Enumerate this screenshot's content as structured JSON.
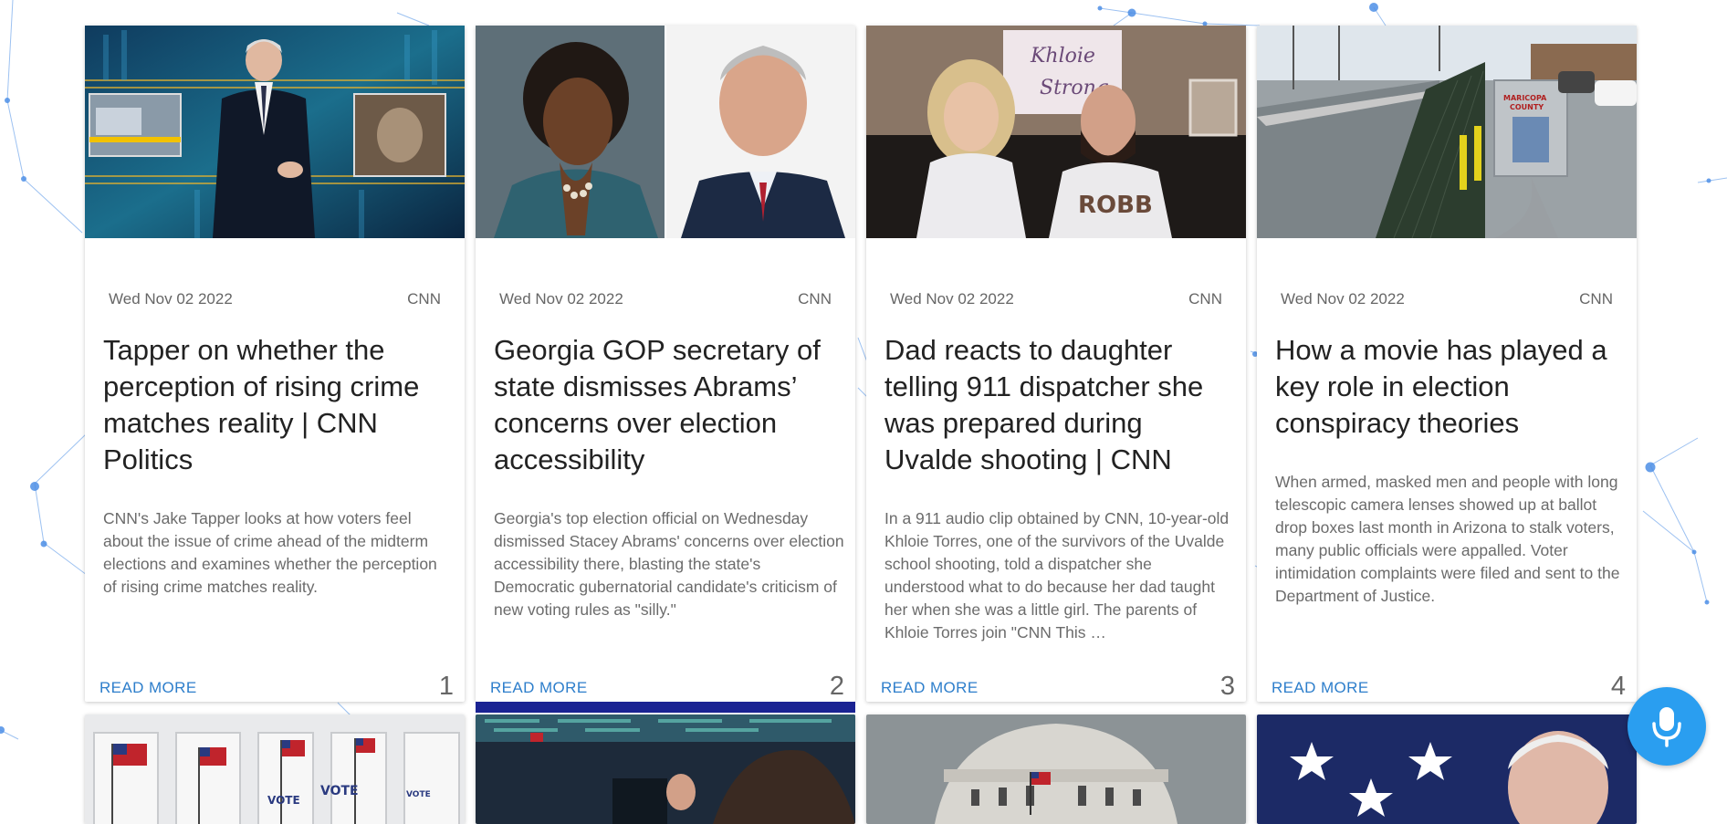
{
  "cards": [
    {
      "date": "Wed Nov 02 2022",
      "source": "CNN",
      "title": "Tapper on whether the perception of rising crime matches reality | CNN Politics",
      "description": "CNN's Jake Tapper looks at how voters feel about the issue of crime ahead of the midterm elections and examines whether the perception of rising crime matches reality.",
      "read_more": "READ MORE",
      "number": "1"
    },
    {
      "date": "Wed Nov 02 2022",
      "source": "CNN",
      "title": "Georgia GOP secretary of state dismisses Abrams’ concerns over election accessibility",
      "description": "Georgia's top election official on Wednesday dismissed Stacey Abrams' concerns over election accessibility there, blasting the state's Democratic gubernatorial candidate's criticism of new voting rules as \"silly.\"",
      "read_more": "READ MORE",
      "number": "2"
    },
    {
      "date": "Wed Nov 02 2022",
      "source": "CNN",
      "title": "Dad reacts to daughter telling 911 dispatcher she was prepared during Uvalde shooting | CNN",
      "description": "In a 911 audio clip obtained by CNN, 10-year-old Khloie Torres, one of the survivors of the Uvalde school shooting, told a dispatcher she understood what to do because her dad taught her when she was a little girl. The parents of Khloie Torres join \"CNN This …",
      "read_more": "READ MORE",
      "number": "3"
    },
    {
      "date": "Wed Nov 02 2022",
      "source": "CNN",
      "title": "How a movie has played a key role in election conspiracy theories",
      "description": "When armed, masked men and people with long telescopic camera lenses showed up at ballot drop boxes last month in Arizona to stalk voters, many public officials were appalled. Voter intimidation complaints were filed and sent to the Department of Justice.",
      "read_more": "READ MORE",
      "number": "4"
    }
  ],
  "thumbnail_text": {
    "sign_line1": "Khloie",
    "sign_line2": "Strong",
    "shirt": "ROBB",
    "box_label1": "MARICOPA",
    "box_label2": "COUNTY",
    "vote1": "VOTE",
    "vote2": "VOTE",
    "vote3": "VOTE"
  },
  "colors": {
    "link": "#2d7ecb",
    "active_bar": "#1a2393",
    "mic_button": "#2a9ef0",
    "network": "#4d8fe6"
  },
  "mic_icon": "microphone-icon"
}
